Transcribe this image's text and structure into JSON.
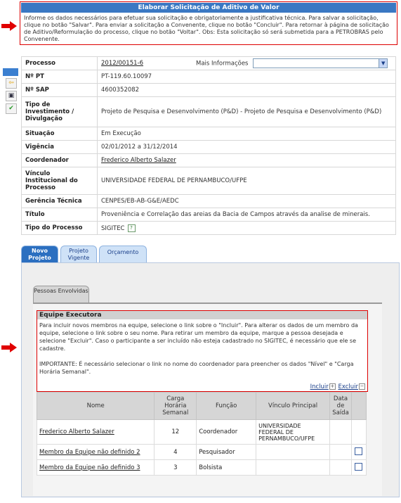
{
  "header": {
    "title": "Elaborar Solicitação de Aditivo de Valor",
    "instructions": "Informe os dados necessários para efetuar sua solicitação e obrigatoriamente a justificativa técnica. Para salvar a solicitação, clique no botão \"Salvar\". Para enviar a solicitação a Convenente, clique no botão \"Concluir\". Para retornar à página de solicitação de Aditivo/Reformulação do processo, clique no botão \"Voltar\". Obs: Esta solicitação só será submetida para a PETROBRAS pelo Convenente."
  },
  "info": {
    "processo_label": "Processo",
    "processo_value": "2012/00151-6",
    "mais_info_label": "Mais Informações",
    "mais_info_selected": "",
    "pt_label": "Nº PT",
    "pt_value": "PT-119.60.10097",
    "sap_label": "Nº SAP",
    "sap_value": "4600352082",
    "tipo_inv_label": "Tipo de Investimento / Divulgação",
    "tipo_inv_value": "Projeto de Pesquisa e Desenvolvimento (P&D) - Projeto de Pesquisa e Desenvolvimento (P&D)",
    "situacao_label": "Situação",
    "situacao_value": "Em Execução",
    "vigencia_label": "Vigência",
    "vigencia_value": "02/01/2012 a 31/12/2014",
    "coordenador_label": "Coordenador",
    "coordenador_value": "Frederico Alberto Salazer",
    "vinculo_label": "Vínculo Institucional do Processo",
    "vinculo_value": "UNIVERSIDADE FEDERAL DE PERNAMBUCO/UFPE",
    "gerencia_label": "Gerência Técnica",
    "gerencia_value": "CENPES/EB-AB-G&E/AEDC",
    "titulo_label": "Título",
    "titulo_value": "Proveniência e Correlação das areias da Bacia de Campos através da analise de minerais.",
    "tipo_proc_label": "Tipo do Processo",
    "tipo_proc_value": "SIGITEC"
  },
  "tabs": [
    {
      "label": "Novo Projeto"
    },
    {
      "label": "Projeto Vigente"
    },
    {
      "label": "Orçamento"
    }
  ],
  "subtab": {
    "label": "Pessoas Envolvidas"
  },
  "equipe": {
    "title": "Equipe Executora",
    "text1": "Para incluir novos membros na equipe, selecione o link sobre o \"Incluir\". Para alterar os dados de um membro da equipe, selecione o link sobre o seu nome. Para retirar um membro da equipe, marque a pessoa desejada e selecione \"Excluir\". Caso o participante a ser incluído não esteja cadastrado no SIGITEC, é necessário que ele se cadastre.",
    "text2": "IMPORTANTE: É necessário selecionar o link no nome do coordenador para preencher os dados \"Nível\" e \"Carga Horária Semanal\".",
    "incluir_label": "Incluir",
    "excluir_label": "Excluir"
  },
  "members": {
    "headers": [
      "Nome",
      "Carga Horária Semanal",
      "Função",
      "Vínculo Principal",
      "Data de Saída"
    ],
    "rows": [
      {
        "nome": "Frederico Alberto Salazer",
        "carga": "12",
        "funcao": "Coordenador",
        "vinculo": "UNIVERSIDADE FEDERAL DE PERNAMBUCO/UFPE",
        "saida": ""
      },
      {
        "nome": "Membro da Equipe não definido 2",
        "carga": "4",
        "funcao": "Pesquisador",
        "vinculo": "",
        "saida": ""
      },
      {
        "nome": "Membro da Equipe não definido 3",
        "carga": "3",
        "funcao": "Bolsista",
        "vinculo": "",
        "saida": ""
      }
    ]
  },
  "colors": {
    "accent_blue": "#3a78c3",
    "highlight_red": "#dd0000"
  },
  "icons": [
    "red-arrow-icon",
    "back-arrow-icon",
    "save-icon",
    "check-icon",
    "help-icon",
    "chevron-down-icon",
    "plus-box-icon",
    "minus-box-icon"
  ]
}
